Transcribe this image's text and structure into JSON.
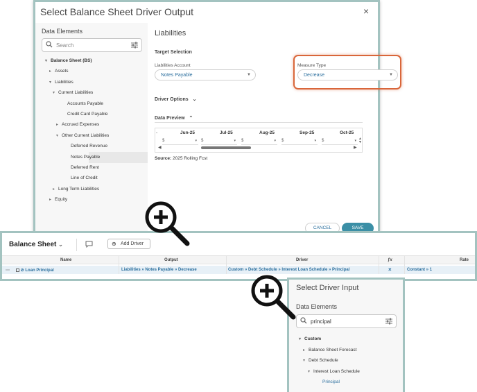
{
  "output_modal": {
    "title": "Select Balance Sheet Driver Output",
    "close_glyph": "×",
    "data_elements_label": "Data Elements",
    "search_placeholder": "Search",
    "tree": [
      {
        "label": "Balance Sheet (BS)",
        "chev": "▾"
      },
      {
        "label": "Assets",
        "chev": "▸"
      },
      {
        "label": "Liabilities",
        "chev": "▾"
      },
      {
        "label": "Current Liabilities",
        "chev": "▾"
      },
      {
        "label": "Accounts Payable",
        "chev": ""
      },
      {
        "label": "Credit Card Payable",
        "chev": ""
      },
      {
        "label": "Accrued Expenses",
        "chev": "▸"
      },
      {
        "label": "Other Current Liabilities",
        "chev": "▾"
      },
      {
        "label": "Deferred Revenue",
        "chev": ""
      },
      {
        "label": "Notes Payable",
        "chev": ""
      },
      {
        "label": "Deferred Rent",
        "chev": ""
      },
      {
        "label": "Line of Credit",
        "chev": ""
      },
      {
        "label": "Long Term Liabilities",
        "chev": "▸"
      },
      {
        "label": "Equity",
        "chev": "▸"
      }
    ],
    "panel_title": "Liabilities",
    "target_selection_label": "Target Selection",
    "liabilities_account_label": "Liabilities Account",
    "liabilities_account_value": "Notes Payable",
    "measure_type_label": "Measure Type",
    "measure_type_value": "Decrease",
    "driver_options_label": "Driver Options",
    "driver_options_chev": "⌄",
    "data_preview_label": "Data Preview",
    "data_preview_chev": "⌃",
    "months": [
      "Jun-25",
      "Jul-25",
      "Aug-25",
      "Sep-25",
      "Oct-25"
    ],
    "cell_prefix": "$",
    "source_label": "Source:",
    "source_value": "2025 Rolling Fcst",
    "cancel_label": "CANCEL",
    "save_label": "SAVE",
    "highlight_color": "#d9663a"
  },
  "grid": {
    "title": "Balance Sheet",
    "title_chev": "⌄",
    "add_driver_label": "Add Driver",
    "columns": [
      "Name",
      "Output",
      "Driver",
      "ƒx",
      "Rate"
    ],
    "row": {
      "name": "Loan Principal",
      "output": "Liabilities » Notes Payable » Decrease",
      "driver": "Custom » Debt Schedule » Interest Loan Schedule » Principal",
      "fx": "×",
      "rate": "Constant » 1"
    }
  },
  "input_modal": {
    "title": "Select Driver Input",
    "data_elements_label": "Data Elements",
    "search_value": "principal",
    "tree": [
      {
        "label": "Custom",
        "chev": "▾"
      },
      {
        "label": "Balance Sheet Forecast",
        "chev": "▸"
      },
      {
        "label": "Debt Schedule",
        "chev": "▾"
      },
      {
        "label": "Interest Loan Schedule",
        "chev": "▾"
      },
      {
        "label": "Principal",
        "chev": ""
      }
    ]
  },
  "icons": [
    "search-icon",
    "filter-icon",
    "close-icon",
    "comment-icon",
    "add-icon",
    "zoom-in-icon",
    "drag-handle-icon"
  ]
}
